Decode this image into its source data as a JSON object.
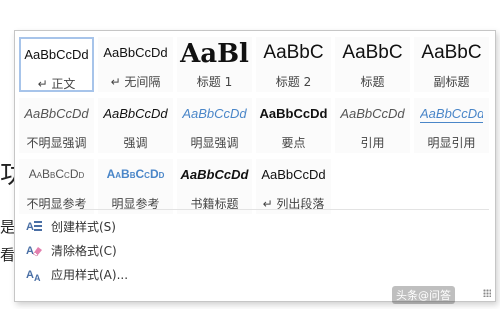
{
  "document": {
    "frag_big": "功",
    "frag_line1": "是,",
    "frag_line2": "看"
  },
  "styles": [
    {
      "sample": "AaBbCcDd",
      "name": "↵ 正文",
      "selected": true
    },
    {
      "sample": "AaBbCcDd",
      "name": "↵ 无间隔"
    },
    {
      "sample": "AaBl",
      "name": "标题 1"
    },
    {
      "sample": "AaBbC",
      "name": "标题 2"
    },
    {
      "sample": "AaBbC",
      "name": "标题"
    },
    {
      "sample": "AaBbC",
      "name": "副标题"
    },
    {
      "sample": "AaBbCcDd",
      "name": "不明显强调"
    },
    {
      "sample": "AaBbCcDd",
      "name": "强调"
    },
    {
      "sample": "AaBbCcDd",
      "name": "明显强调"
    },
    {
      "sample": "AaBbCcDd",
      "name": "要点"
    },
    {
      "sample": "AaBbCcDd",
      "name": "引用"
    },
    {
      "sample": "AaBbCcDd",
      "name": "明显引用"
    },
    {
      "sample": "AaBbCcDd",
      "name": "不明显参考"
    },
    {
      "sample": "AaBbCcDd",
      "name": "明显参考"
    },
    {
      "sample": "AaBbCcDd",
      "name": "书籍标题"
    },
    {
      "sample": "AaBbCcDd",
      "name": "↵ 列出段落"
    }
  ],
  "menu": {
    "create": "创建样式(S)",
    "clear": "清除格式(C)",
    "apply": "应用样式(A)..."
  },
  "icons": {
    "create": "create-style-icon",
    "clear": "clear-format-icon",
    "apply": "apply-style-icon",
    "grip": "resize-grip-icon"
  },
  "watermark": "头条@问答",
  "colors": {
    "accent_blue": "#4a86c8",
    "selection_border": "#a7c4ea"
  }
}
